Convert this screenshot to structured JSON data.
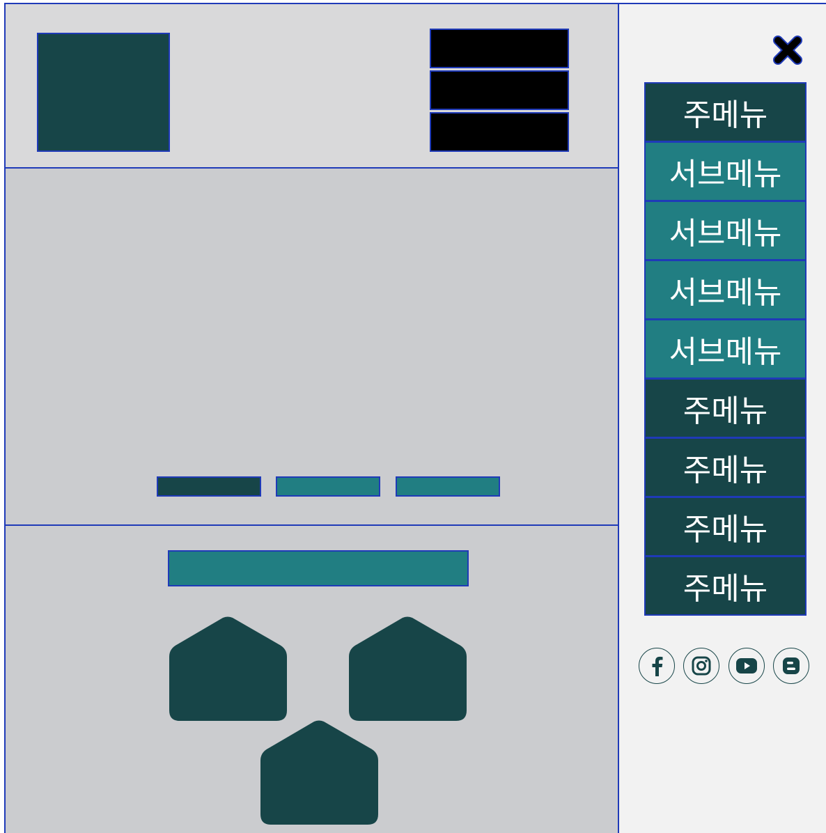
{
  "header": {
    "logo_icon": "logo-placeholder",
    "menu_icon": "hamburger-icon"
  },
  "hero": {
    "slides": 3,
    "active_slide": 1
  },
  "content": {
    "cards_icon": "house-icon"
  },
  "sidebar": {
    "close_icon": "close-icon",
    "menu": [
      {
        "label": "주메뉴",
        "type": "main"
      },
      {
        "label": "서브메뉴",
        "type": "sub"
      },
      {
        "label": "서브메뉴",
        "type": "sub"
      },
      {
        "label": "서브메뉴",
        "type": "sub"
      },
      {
        "label": "서브메뉴",
        "type": "sub"
      },
      {
        "label": "주메뉴",
        "type": "main"
      },
      {
        "label": "주메뉴",
        "type": "main"
      },
      {
        "label": "주메뉴",
        "type": "main"
      },
      {
        "label": "주메뉴",
        "type": "main"
      }
    ],
    "social": [
      {
        "icon": "facebook-icon"
      },
      {
        "icon": "instagram-icon"
      },
      {
        "icon": "youtube-icon"
      },
      {
        "icon": "blogger-icon"
      }
    ]
  },
  "colors": {
    "dark_teal": "#174548",
    "teal": "#217e82",
    "border_blue": "#1f3ab8",
    "header_bg": "#d9d9da",
    "body_bg": "#cbcccf",
    "sidebar_bg": "#f2f2f2"
  }
}
